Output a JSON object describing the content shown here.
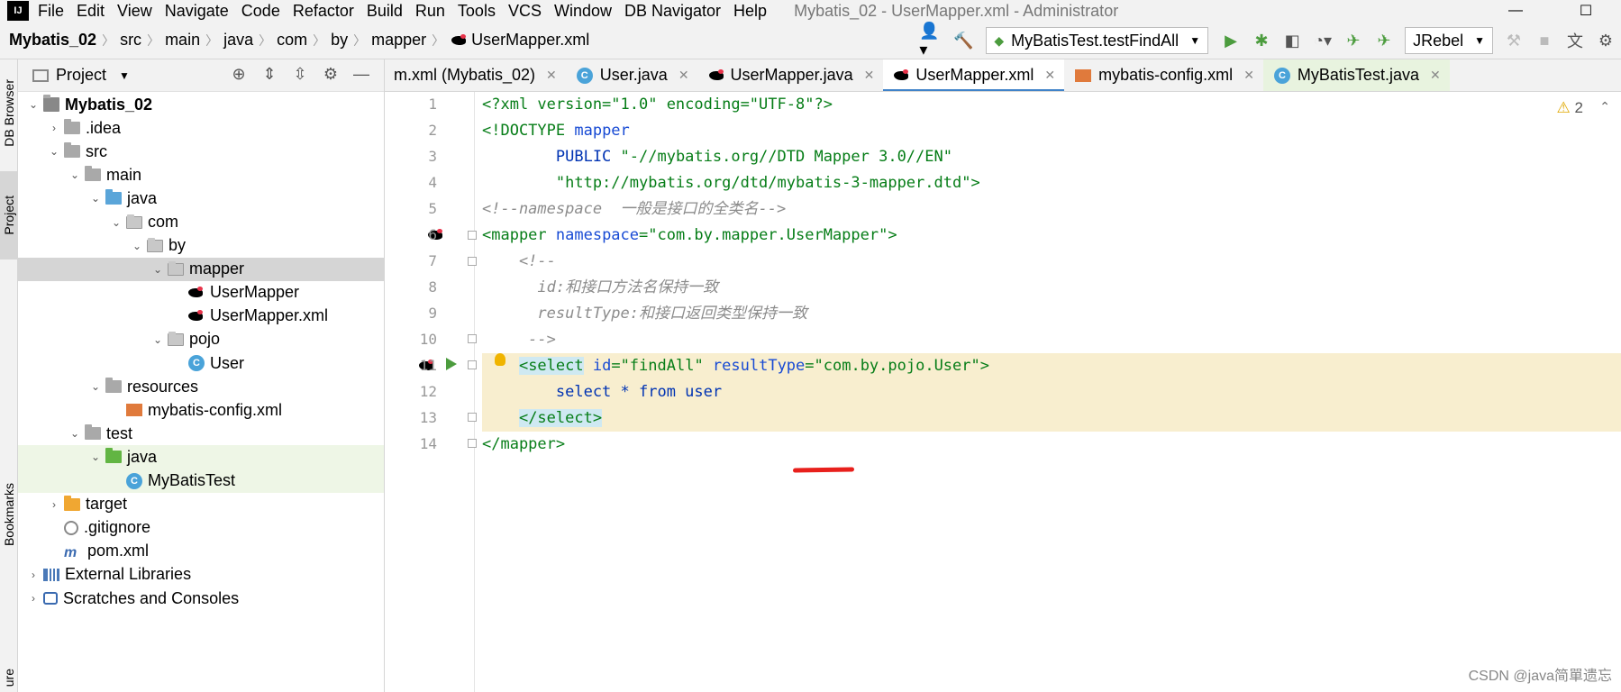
{
  "app": {
    "window_title": "Mybatis_02 - UserMapper.xml - Administrator",
    "menu": [
      "File",
      "Edit",
      "View",
      "Navigate",
      "Code",
      "Refactor",
      "Build",
      "Run",
      "Tools",
      "VCS",
      "Window",
      "DB Navigator",
      "Help"
    ],
    "minimize": "—",
    "maximize": "☐"
  },
  "breadcrumb": [
    "Mybatis_02",
    "src",
    "main",
    "java",
    "com",
    "by",
    "mapper",
    "UserMapper.xml"
  ],
  "toolbar": {
    "run_config": "MyBatisTest.testFindAll",
    "jrebel": "JRebel"
  },
  "left_strip": {
    "db_browser": "DB Browser",
    "project": "Project",
    "bookmarks": "Bookmarks",
    "structure": "ure"
  },
  "project_panel": {
    "title": "Project"
  },
  "tree": [
    {
      "label": "Mybatis_02",
      "depth": 0,
      "arrow": "⌄",
      "icon": "module",
      "bold": true
    },
    {
      "label": ".idea",
      "depth": 1,
      "arrow": "›",
      "icon": "folder"
    },
    {
      "label": "src",
      "depth": 1,
      "arrow": "⌄",
      "icon": "folder"
    },
    {
      "label": "main",
      "depth": 2,
      "arrow": "⌄",
      "icon": "folder"
    },
    {
      "label": "java",
      "depth": 3,
      "arrow": "⌄",
      "icon": "folder-blue"
    },
    {
      "label": "com",
      "depth": 4,
      "arrow": "⌄",
      "icon": "pkg"
    },
    {
      "label": "by",
      "depth": 5,
      "arrow": "⌄",
      "icon": "pkg"
    },
    {
      "label": "mapper",
      "depth": 6,
      "arrow": "⌄",
      "icon": "pkg",
      "selected": true
    },
    {
      "label": "UserMapper",
      "depth": 7,
      "arrow": "",
      "icon": "bird"
    },
    {
      "label": "UserMapper.xml",
      "depth": 7,
      "arrow": "",
      "icon": "bird"
    },
    {
      "label": "pojo",
      "depth": 6,
      "arrow": "⌄",
      "icon": "pkg"
    },
    {
      "label": "User",
      "depth": 7,
      "arrow": "",
      "icon": "class"
    },
    {
      "label": "resources",
      "depth": 3,
      "arrow": "⌄",
      "icon": "folder"
    },
    {
      "label": "mybatis-config.xml",
      "depth": 4,
      "arrow": "",
      "icon": "xml"
    },
    {
      "label": "test",
      "depth": 2,
      "arrow": "⌄",
      "icon": "folder"
    },
    {
      "label": "java",
      "depth": 3,
      "arrow": "⌄",
      "icon": "folder-green",
      "test": true
    },
    {
      "label": "MyBatisTest",
      "depth": 4,
      "arrow": "",
      "icon": "class",
      "test": true
    },
    {
      "label": "target",
      "depth": 1,
      "arrow": "›",
      "icon": "folder-orange"
    },
    {
      "label": ".gitignore",
      "depth": 1,
      "arrow": "",
      "icon": "git"
    },
    {
      "label": "pom.xml",
      "depth": 1,
      "arrow": "",
      "icon": "maven"
    },
    {
      "label": "External Libraries",
      "depth": 0,
      "arrow": "›",
      "icon": "lib"
    },
    {
      "label": "Scratches and Consoles",
      "depth": 0,
      "arrow": "›",
      "icon": "scratch"
    }
  ],
  "tabs": [
    {
      "label": "m.xml (Mybatis_02)",
      "icon": "",
      "active": false
    },
    {
      "label": "User.java",
      "icon": "class",
      "active": false
    },
    {
      "label": "UserMapper.java",
      "icon": "bird",
      "active": false
    },
    {
      "label": "UserMapper.xml",
      "icon": "bird",
      "active": true
    },
    {
      "label": "mybatis-config.xml",
      "icon": "xml",
      "active": false
    },
    {
      "label": "MyBatisTest.java",
      "icon": "class",
      "active": false,
      "test": true
    }
  ],
  "editor": {
    "warning_count": "2",
    "line_numbers": [
      "1",
      "2",
      "3",
      "4",
      "5",
      "6",
      "7",
      "8",
      "9",
      "10",
      "11",
      "12",
      "13",
      "14"
    ],
    "lines": [
      [
        {
          "t": "<?xml version=\"1.0\" encoding=\"UTF-8\"?>",
          "c": "c-pi"
        }
      ],
      [
        {
          "t": "<!DOCTYPE ",
          "c": "c-green"
        },
        {
          "t": "mapper",
          "c": "c-blue"
        }
      ],
      [
        {
          "t": "        PUBLIC ",
          "c": "c-kw"
        },
        {
          "t": "\"-//mybatis.org//DTD Mapper 3.0//EN\"",
          "c": "c-green"
        }
      ],
      [
        {
          "t": "        \"http://mybatis.org/dtd/mybatis-3-mapper.dtd\">",
          "c": "c-green"
        }
      ],
      [
        {
          "t": "<!--namespace  一般是接口的全类名-->",
          "c": "c-gray"
        }
      ],
      [
        {
          "t": "<mapper ",
          "c": "c-tag"
        },
        {
          "t": "namespace",
          "c": "c-attr"
        },
        {
          "t": "=\"com.by.mapper.UserMapper\">",
          "c": "c-val"
        }
      ],
      [
        {
          "t": "    <!--",
          "c": "c-gray"
        }
      ],
      [
        {
          "t": "      id:和接口方法名保持一致",
          "c": "c-gray"
        }
      ],
      [
        {
          "t": "      resultType:和接口返回类型保持一致",
          "c": "c-gray"
        }
      ],
      [
        {
          "t": "     -->",
          "c": "c-gray"
        }
      ],
      [
        {
          "t": "    ",
          "c": ""
        },
        {
          "t": "<select",
          "c": "c-tag tag-hl"
        },
        {
          "t": " id",
          "c": "c-attr"
        },
        {
          "t": "=\"findAll\" ",
          "c": "c-val"
        },
        {
          "t": "resultType",
          "c": "c-attr"
        },
        {
          "t": "=\"com.by.pojo.User\">",
          "c": "c-val"
        }
      ],
      [
        {
          "t": "        select * from ",
          "c": "c-kw"
        },
        {
          "t": "user",
          "c": "c-kw"
        }
      ],
      [
        {
          "t": "    ",
          "c": ""
        },
        {
          "t": "</select>",
          "c": "c-tag tag-hl"
        }
      ],
      [
        {
          "t": "</mapper>",
          "c": "c-tag"
        }
      ]
    ]
  },
  "watermark": "CSDN @java简單遗忘"
}
